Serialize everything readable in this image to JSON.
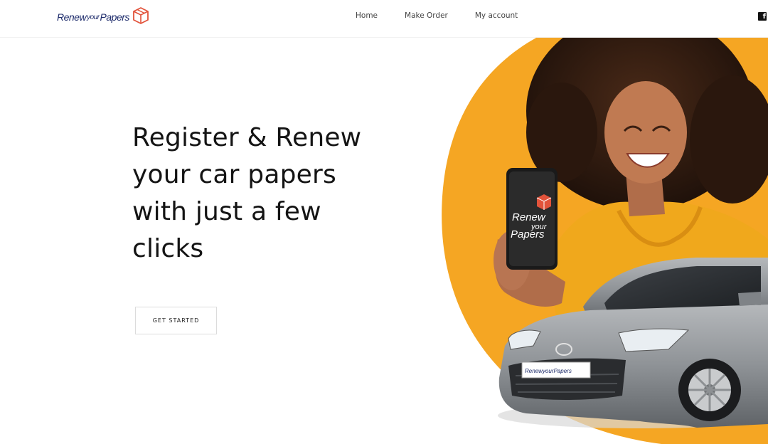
{
  "brand": {
    "logo_part1": "Renew",
    "logo_part2": "your",
    "logo_part3": "Papers",
    "accent_color": "#e2533b",
    "navy_color": "#1d2b6b"
  },
  "nav": {
    "items": [
      {
        "label": "Home"
      },
      {
        "label": "Make Order"
      },
      {
        "label": "My account"
      }
    ],
    "social_icon": "facebook-icon"
  },
  "hero": {
    "title": "Register & Renew your car papers with just a few clicks",
    "cta_label": "GET STARTED"
  },
  "illustration": {
    "phone_text_1": "Renew",
    "phone_text_2": "your",
    "phone_text_3": "Papers",
    "plate_text": "RenewyourPapers",
    "circle_color": "#f5a623",
    "car_color": "#8e9296"
  }
}
